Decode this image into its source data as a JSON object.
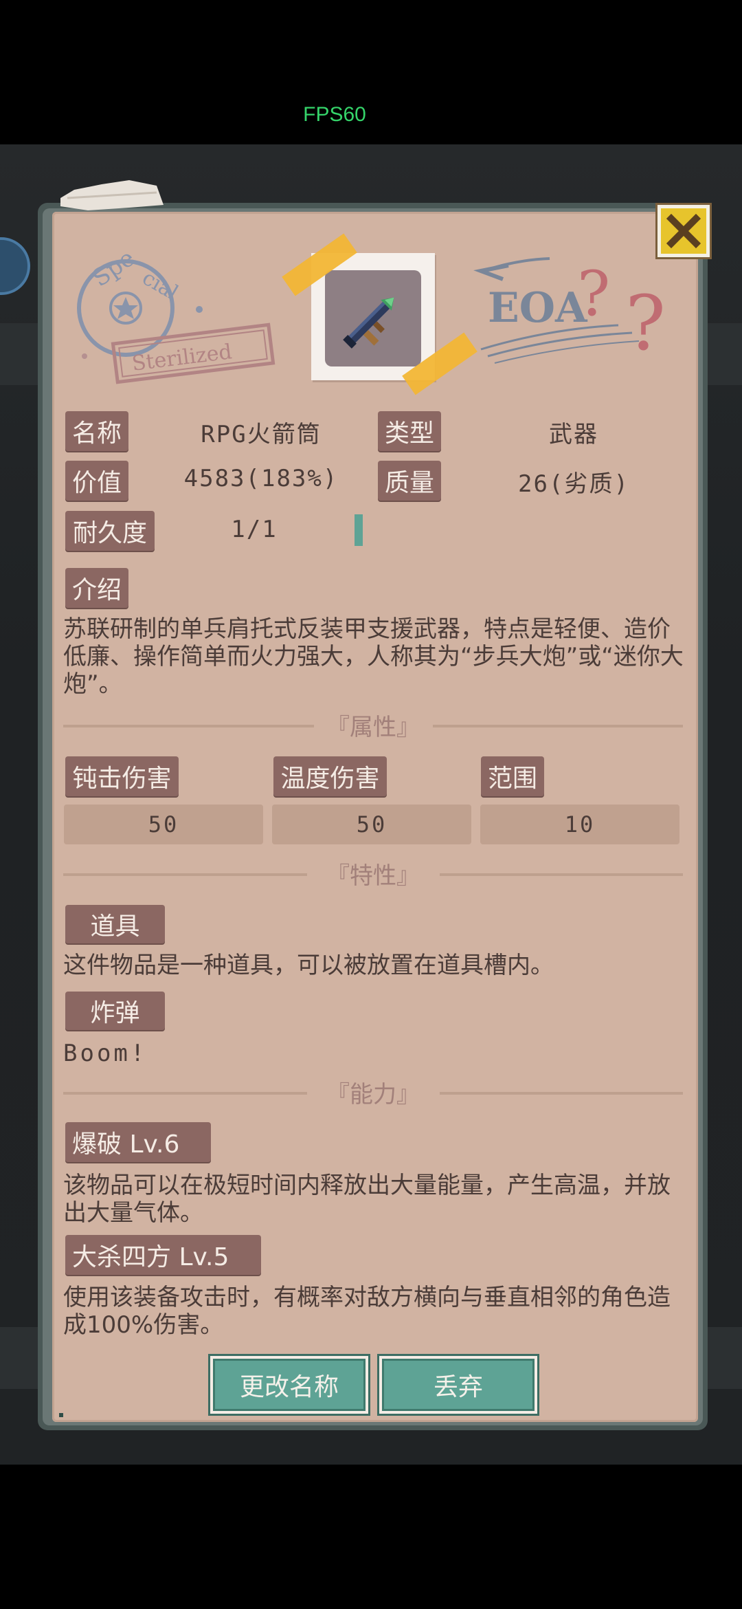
{
  "status_bar": {
    "fps": "FPS60"
  },
  "header": {
    "stamp_text": "Special",
    "stamp_label": "Sterilized",
    "brand": "EOA"
  },
  "info": {
    "name_label": "名称",
    "name_value": "RPG火箭筒",
    "type_label": "类型",
    "type_value": "武器",
    "price_label": "价值",
    "price_value": "4583(183%)",
    "quality_label": "质量",
    "quality_value": "26(劣质)",
    "durability_label": "耐久度",
    "durability_value": "1/1",
    "durability_fraction": 1.0
  },
  "intro": {
    "label": "介绍",
    "text": "苏联研制的单兵肩托式反装甲支援武器，特点是轻便、造价低廉、操作简单而火力强大，人称其为“步兵大炮”或“迷你大炮”。"
  },
  "attributes": {
    "title": "『属性』",
    "items": [
      {
        "label": "钝击伤害",
        "value": "50"
      },
      {
        "label": "温度伤害",
        "value": "50"
      },
      {
        "label": "范围",
        "value": "10"
      }
    ]
  },
  "traits": {
    "title": "『特性』",
    "items": [
      {
        "label": "道具",
        "text": "这件物品是一种道具，可以被放置在道具槽内。"
      },
      {
        "label": "炸弹",
        "text": "Boom!"
      }
    ]
  },
  "abilities": {
    "title": "『能力』",
    "items": [
      {
        "label": "爆破 Lv.6",
        "text": "该物品可以在极短时间内释放出大量能量，产生高温，并放出大量气体。"
      },
      {
        "label": "大杀四方 Lv.5",
        "text": "使用该装备攻击时，有概率对敌方横向与垂直相邻的角色造成100%伤害。"
      }
    ]
  },
  "buttons": {
    "rename": "更改名称",
    "discard": "丢弃"
  },
  "colors": {
    "panel": "#d1b3a2",
    "tag": "#8b6762",
    "button": "#5ea395",
    "close": "#e7c42c"
  }
}
